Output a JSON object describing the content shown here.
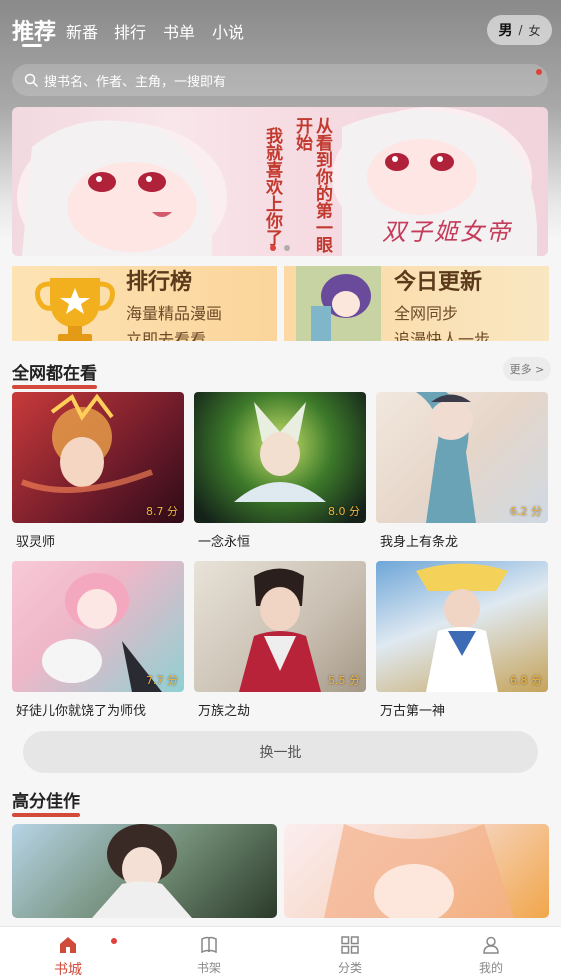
{
  "top_tabs": [
    "推荐",
    "新番",
    "排行",
    "书单",
    "小说"
  ],
  "gender": {
    "male": "男",
    "separator": "/",
    "female": "女"
  },
  "search": {
    "placeholder": "搜书名、作者、主角，一搜即有"
  },
  "banner": {
    "slogan_lines": [
      "从看到你的第一眼开始",
      "我就喜欢上你了"
    ],
    "title_text": "双子姬女帝"
  },
  "promos": [
    {
      "title": "排行榜",
      "line1": "海量精品漫画",
      "line2": "立即去看看"
    },
    {
      "title": "今日更新",
      "line1": "全网同步",
      "line2": "追漫快人一步"
    }
  ],
  "section_popular": {
    "title": "全网都在看",
    "more": "更多 >"
  },
  "popular_items": [
    {
      "title": "驭灵师",
      "score": "8.7 分"
    },
    {
      "title": "一念永恒",
      "score": "8.0 分"
    },
    {
      "title": "我身上有条龙",
      "score": "6.2 分"
    },
    {
      "title": "好徒儿你就饶了为师伐",
      "score": "7.7 分"
    },
    {
      "title": "万族之劫",
      "score": "5.5 分"
    },
    {
      "title": "万古第一神",
      "score": "6.8 分"
    }
  ],
  "refresh_label": "换一批",
  "section_high": {
    "title": "高分佳作"
  },
  "bottom_nav": [
    {
      "label": "书城",
      "icon": "home-icon"
    },
    {
      "label": "书架",
      "icon": "bookshelf-icon"
    },
    {
      "label": "分类",
      "icon": "category-grid-icon"
    },
    {
      "label": "我的",
      "icon": "profile-icon"
    }
  ],
  "colors": {
    "accent": "#d14b3b",
    "score": "#f0b43c",
    "promo_bg": "#fde3b4"
  }
}
